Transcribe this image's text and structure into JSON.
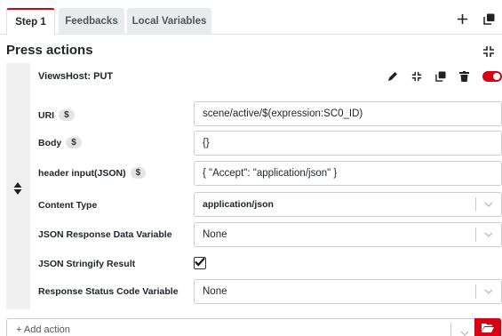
{
  "tabs": [
    {
      "label": "Step 1",
      "active": true
    },
    {
      "label": "Feedbacks",
      "active": false
    },
    {
      "label": "Local Variables",
      "active": false
    }
  ],
  "section": {
    "title": "Press actions"
  },
  "action": {
    "name": "ViewsHost: PUT",
    "enabled": true,
    "rows": {
      "uri": {
        "label": "URI",
        "badge": "$",
        "value": "scene/active/$(expression:SC0_ID)"
      },
      "body": {
        "label": "Body",
        "badge": "$",
        "value": "{}"
      },
      "header": {
        "label": "header input(JSON)",
        "badge": "$",
        "value": "{ \"Accept\": \"application/json\" }"
      },
      "content_type": {
        "label": "Content Type",
        "value": "application/json"
      },
      "json_response": {
        "label": "JSON Response Data Variable",
        "value": "None"
      },
      "stringify": {
        "label": "JSON Stringify Result",
        "checked": true
      },
      "status_code": {
        "label": "Response Status Code Variable",
        "value": "None"
      }
    }
  },
  "add_action": {
    "placeholder": "+ Add action"
  },
  "colors": {
    "accent": "#d50215",
    "drag_bg": "#f0f0f0",
    "border": "#cccccc"
  },
  "icons": [
    "plus-icon",
    "copy-icon",
    "collapse-icon",
    "edit-icon",
    "trash-icon",
    "sort-icon",
    "chevron-down-icon",
    "folder-open-icon",
    "check-icon"
  ]
}
